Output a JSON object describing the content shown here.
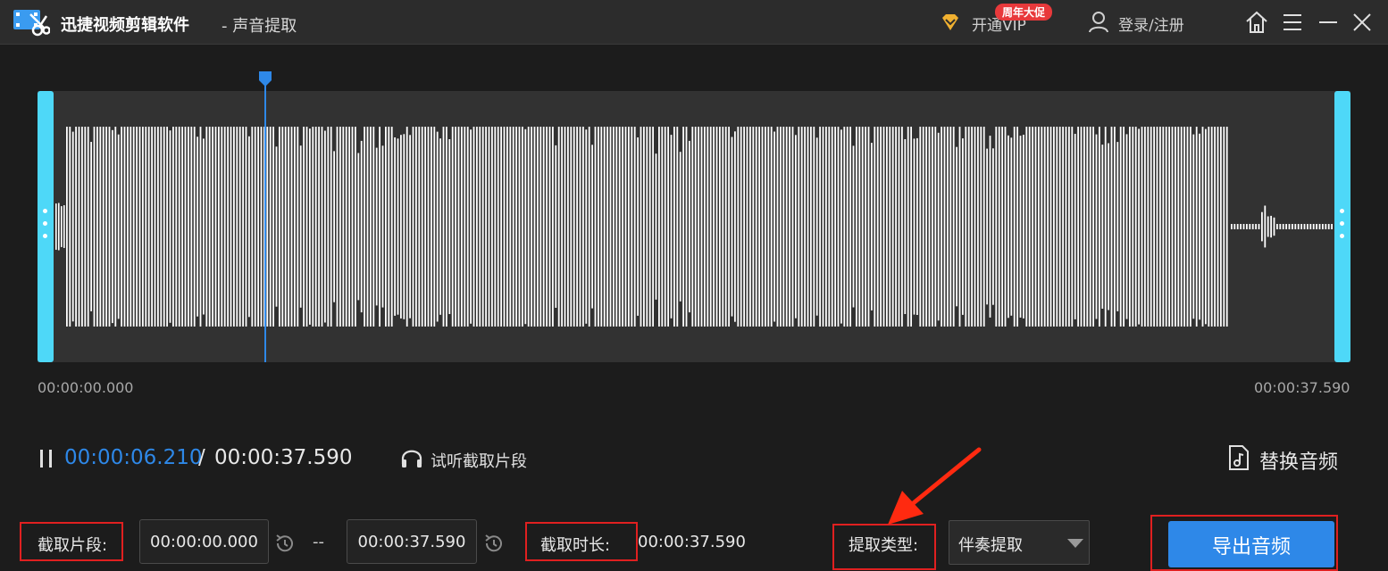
{
  "titlebar": {
    "app_name": "迅捷视频剪辑软件",
    "subtitle": "- 声音提取",
    "vip_label": "开通VIP",
    "vip_badge": "周年大促",
    "login_label": "登录/注册",
    "icons": [
      "home-icon",
      "menu-icon",
      "minimize-icon",
      "close-icon"
    ]
  },
  "timeline": {
    "start": "00:00:00.000",
    "end": "00:00:37.590",
    "playhead_fraction": 0.1737
  },
  "transport": {
    "current_time": "00:00:06.210",
    "separator": "/",
    "total_time": "00:00:37.590",
    "preview_label": "试听截取片段",
    "replace_label": "替换音频"
  },
  "clip": {
    "segment_label": "截取片段:",
    "start_value": "00:00:00.000",
    "dash": "--",
    "end_value": "00:00:37.590",
    "duration_label": "截取时长:",
    "duration_value": "00:00:37.590"
  },
  "extract": {
    "type_label": "提取类型:",
    "type_value": "伴奏提取",
    "export_label": "导出音频"
  },
  "colors": {
    "accent": "#2e88e8",
    "handle": "#4ed8f8",
    "highlight": "#e02020"
  }
}
